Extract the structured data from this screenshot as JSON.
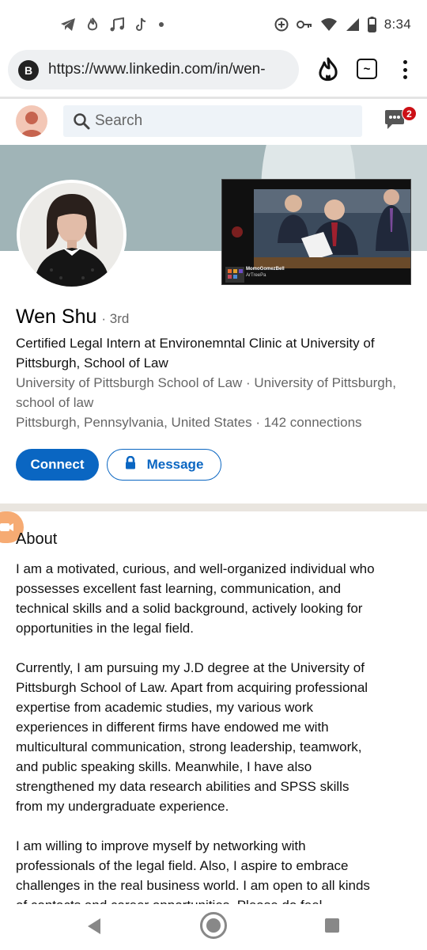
{
  "status_bar": {
    "time": "8:34",
    "left_icons": [
      "telegram-icon",
      "fire-notification-icon",
      "music-icon",
      "tiktok-icon",
      "dot-icon"
    ],
    "right_icons": [
      "hotspot-icon",
      "vpn-key-icon",
      "wifi-icon",
      "signal-icon",
      "battery-icon"
    ]
  },
  "browser": {
    "site_badge": "B",
    "url": "https://www.linkedin.com/in/wen-",
    "ext_label": "~"
  },
  "header": {
    "search_placeholder": "Search",
    "messages_badge": "2"
  },
  "video": {
    "caption_name": "MomoGomezBell",
    "caption_sub": "ArTreePa"
  },
  "profile": {
    "name": "Wen Shu",
    "degree": "· 3rd",
    "headline": "Certified Legal Intern at Environemntal Clinic at University of Pittsburgh, School of Law",
    "education": "University of Pittsburgh School of Law · University of Pittsburgh, school of law",
    "location": "Pittsburgh, Pennsylvania, United States · 142 connections",
    "connect_label": "Connect",
    "message_label": "Message"
  },
  "about": {
    "title": "About",
    "paragraphs": [
      "I am a motivated, curious, and well-organized individual who possesses excellent fast learning, communication, and technical skills and a solid background, actively looking for opportunities in the legal field.",
      "Currently, I am pursuing my J.D degree at the University of Pittsburgh School of Law. Apart from acquiring professional expertise from academic studies, my various work experiences in different firms have endowed me with multicultural communication, strong leadership, teamwork, and public speaking skills. Meanwhile, I have also strengthened my data research abilities and SPSS skills from my undergraduate experience.",
      "I am willing to improve myself by networking with professionals of the legal field. Also, I aspire to embrace challenges in the real business world. I am open to all kinds of contacts and career opportunities. Please do feel"
    ]
  },
  "colors": {
    "linkedin_blue": "#0a66c2",
    "cover_base": "#a0b4b7",
    "badge_red": "#cc1016",
    "separator": "#e9e5df"
  }
}
